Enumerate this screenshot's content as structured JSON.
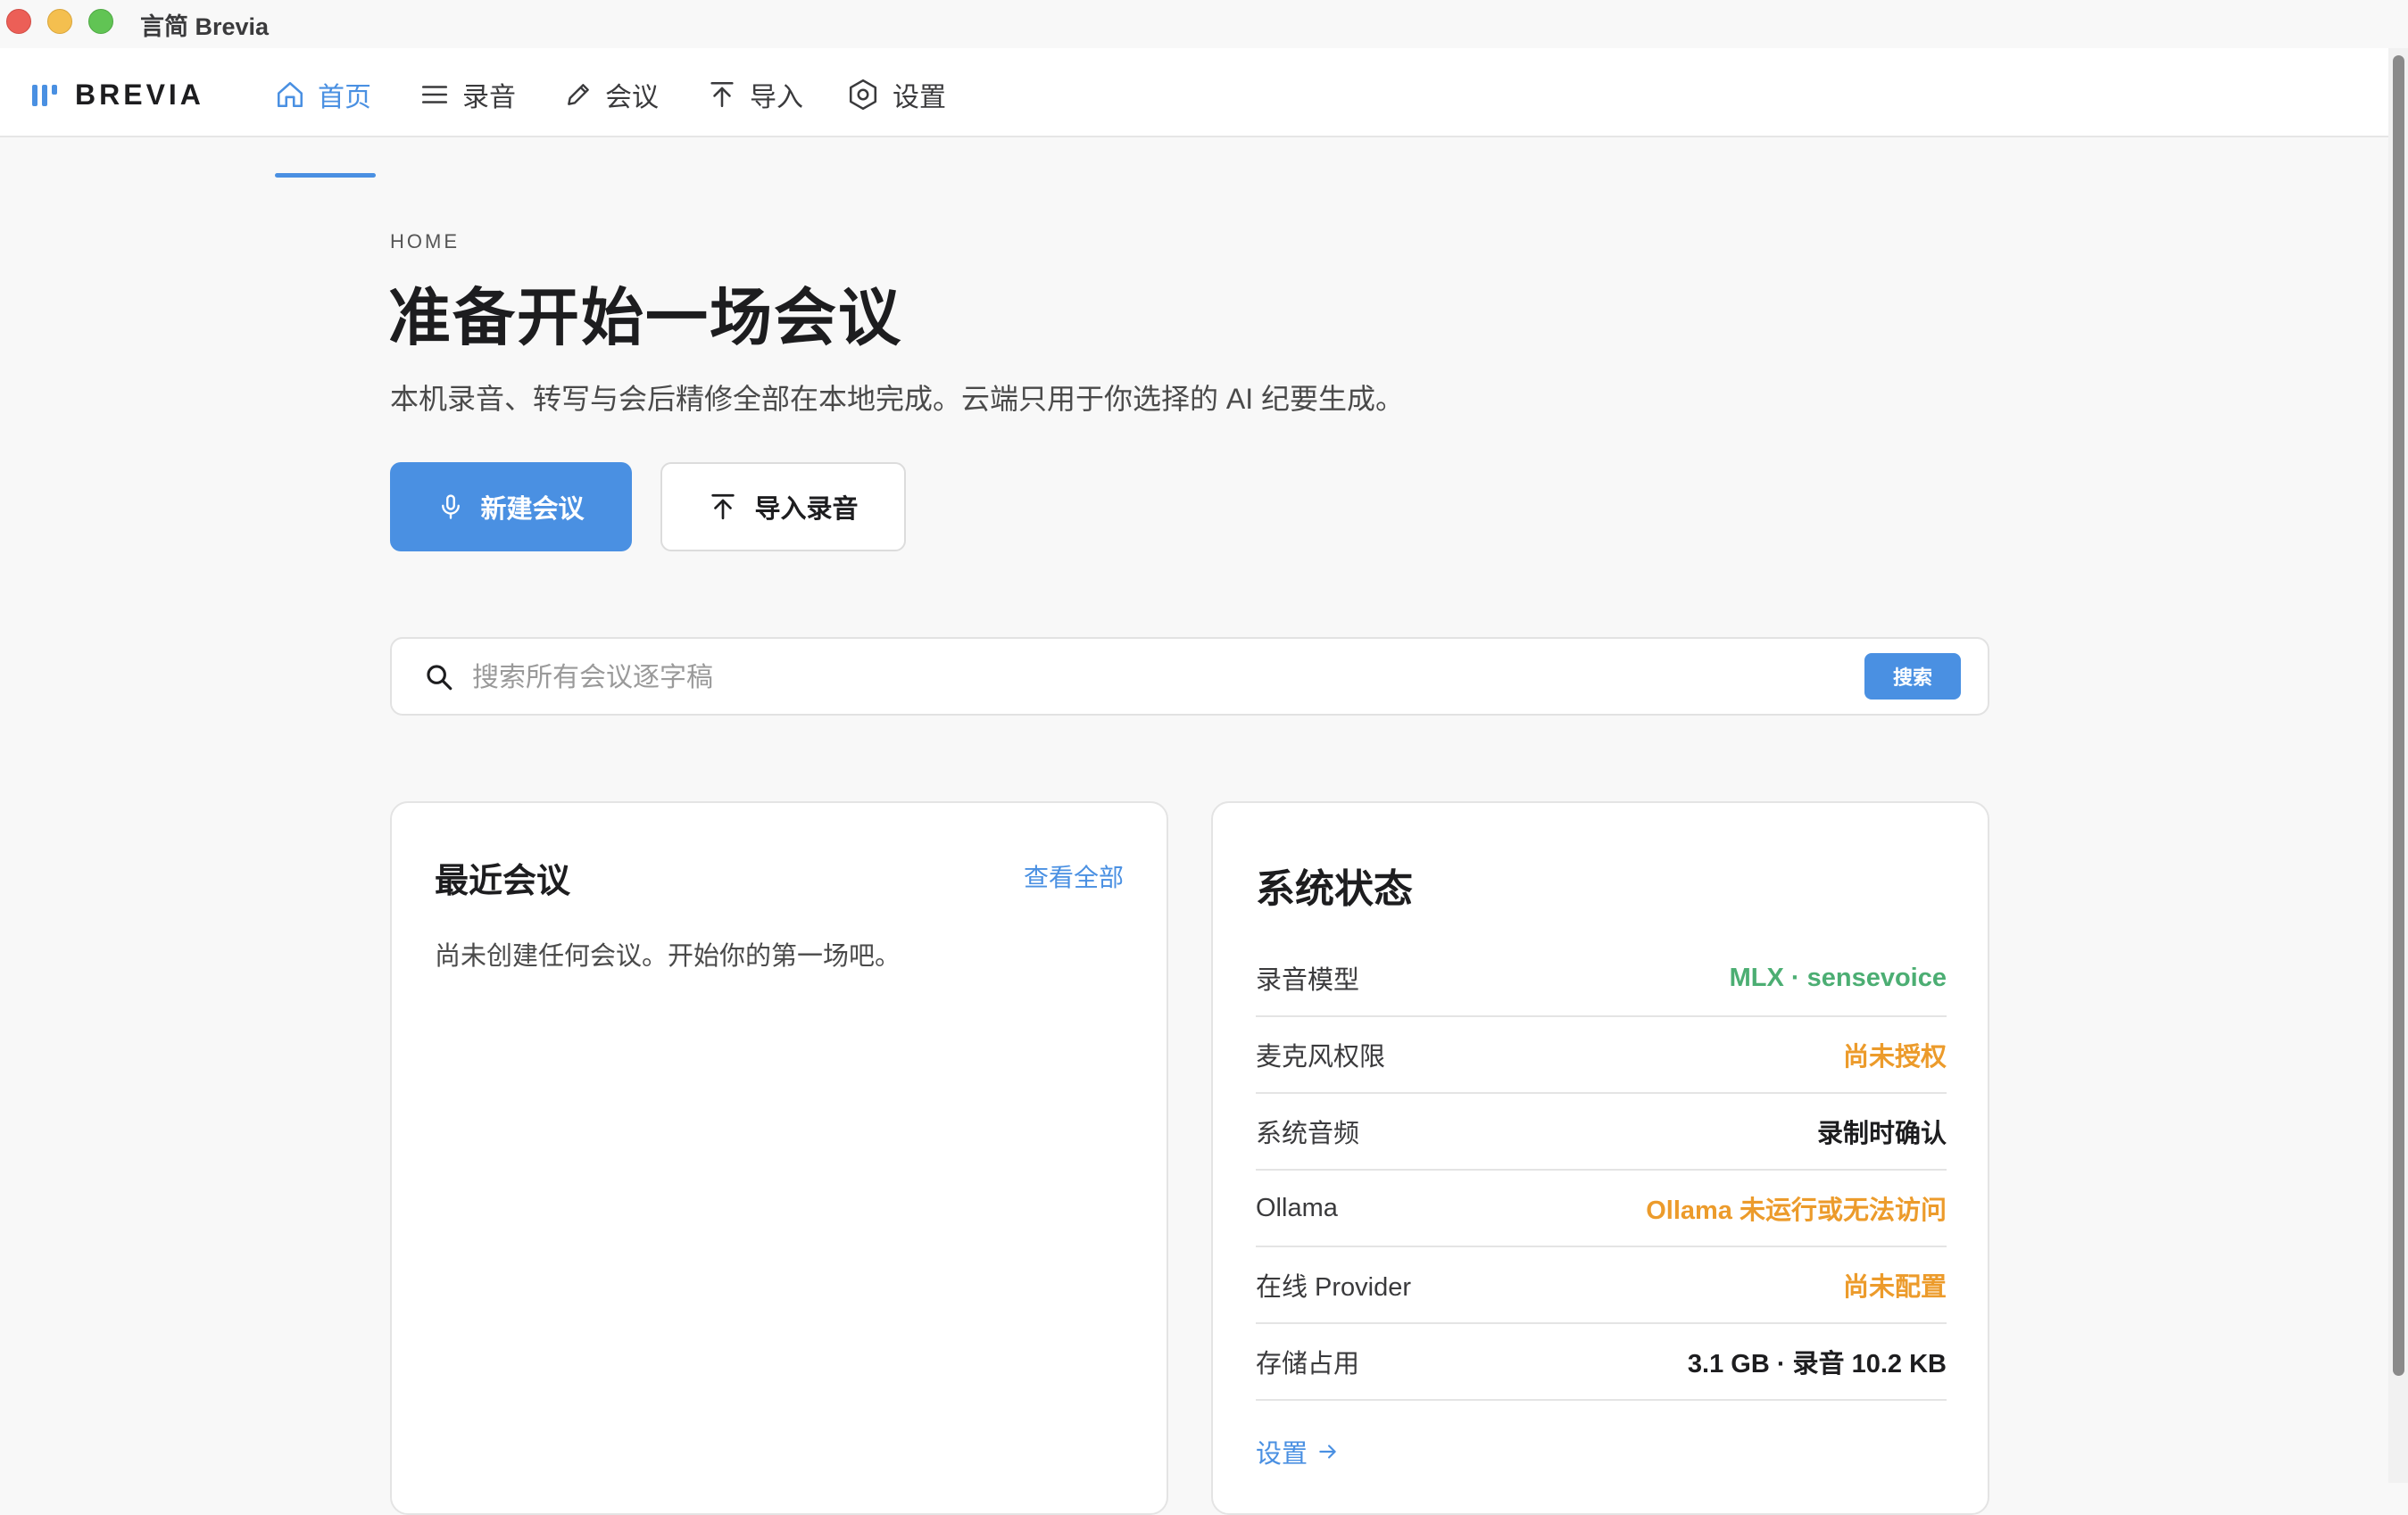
{
  "window": {
    "title": "言简 Brevia"
  },
  "brand": {
    "name": "BREVIA",
    "accent": "#4a90e2"
  },
  "nav": {
    "items": [
      {
        "label": "首页",
        "icon": "home-icon",
        "active": true
      },
      {
        "label": "录音",
        "icon": "list-icon",
        "active": false
      },
      {
        "label": "会议",
        "icon": "pencil-icon",
        "active": false
      },
      {
        "label": "导入",
        "icon": "import-icon",
        "active": false
      },
      {
        "label": "设置",
        "icon": "gear-icon",
        "active": false
      }
    ]
  },
  "hero": {
    "eyebrow": "HOME",
    "title": "准备开始一场会议",
    "subtitle": "本机录音、转写与会后精修全部在本地完成。云端只用于你选择的 AI 纪要生成。",
    "primary_button": "新建会议",
    "secondary_button": "导入录音"
  },
  "search": {
    "placeholder": "搜索所有会议逐字稿",
    "value": "",
    "button": "搜索"
  },
  "recent": {
    "title": "最近会议",
    "view_all": "查看全部",
    "empty": "尚未创建任何会议。开始你的第一场吧。"
  },
  "status": {
    "title": "系统状态",
    "rows": [
      {
        "label": "录音模型",
        "value": "MLX · sensevoice",
        "color": "#4cae73"
      },
      {
        "label": "麦克风权限",
        "value": "尚未授权",
        "color": "#ec9b2b"
      },
      {
        "label": "系统音频",
        "value": "录制时确认",
        "color": "#1d1d1f"
      },
      {
        "label": "Ollama",
        "value": "Ollama 未运行或无法访问",
        "color": "#ec9b2b"
      },
      {
        "label": "在线 Provider",
        "value": "尚未配置",
        "color": "#ec9b2b"
      },
      {
        "label": "存储占用",
        "value": "3.1 GB · 录音 10.2 KB",
        "color": "#1d1d1f"
      }
    ],
    "settings_link": "设置"
  }
}
